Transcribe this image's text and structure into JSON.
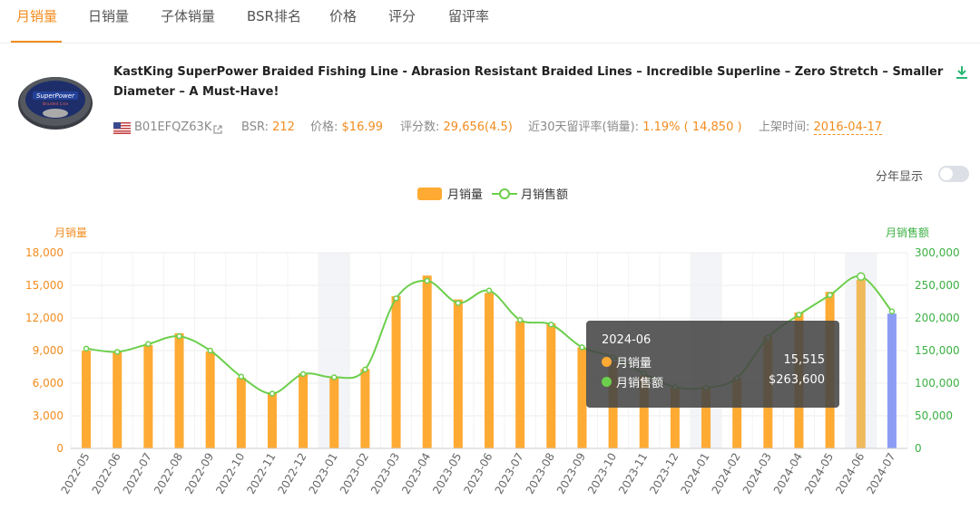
{
  "tabs": [
    {
      "label": "月销量",
      "active": true
    },
    {
      "label": "日销量",
      "active": false
    },
    {
      "label": "子体销量",
      "active": false
    },
    {
      "label": "BSR排名",
      "active": false
    },
    {
      "label": "价格",
      "active": false
    },
    {
      "label": "评分",
      "active": false
    },
    {
      "label": "留评率",
      "active": false
    }
  ],
  "product": {
    "title": "KastKing SuperPower Braided Fishing Line - Abrasion Resistant Braided Lines – Incredible Superline – Zero Stretch – Smaller Diameter – A Must-Have!",
    "asin": "B01EFQZ63K",
    "bsr_label": "BSR:",
    "bsr_value": "212",
    "price_label": "价格:",
    "price_value": "$16.99",
    "ratings_label": "评分数:",
    "ratings_value": "29,656(4.5)",
    "review_rate_label": "近30天留评率(销量):",
    "review_rate_value": "1.19% ( 14,850 )",
    "listed_label": "上架时间:",
    "listed_value": "2016-04-17",
    "spool_brand": "SuperPower",
    "spool_sub": "Braided Line"
  },
  "controls": {
    "year_toggle_label": "分年显示",
    "year_toggle_on": false
  },
  "colors": {
    "accent": "#f28c1e",
    "bar": "#ffaa33",
    "bar_highlight": "#f0b95a",
    "bar_last": "#8c9cf5",
    "line": "#6ccf4c",
    "band": "#f3f4f8"
  },
  "chart_data": {
    "type": "bar",
    "legend": [
      {
        "name": "月销量",
        "kind": "bar"
      },
      {
        "name": "月销售额",
        "kind": "line"
      }
    ],
    "left_axis": {
      "title": "月销量",
      "min": 0,
      "max": 18000,
      "ticks": [
        "0",
        "3,000",
        "6,000",
        "9,000",
        "12,000",
        "15,000",
        "18,000"
      ]
    },
    "right_axis": {
      "title": "月销售额",
      "min": 0,
      "max": 300000,
      "ticks": [
        "0",
        "50,000",
        "100,000",
        "150,000",
        "200,000",
        "250,000",
        "300,000"
      ]
    },
    "categories": [
      "2022-05",
      "2022-06",
      "2022-07",
      "2022-08",
      "2022-09",
      "2022-10",
      "2022-11",
      "2022-12",
      "2023-01",
      "2023-02",
      "2023-03",
      "2023-04",
      "2023-05",
      "2023-06",
      "2023-07",
      "2023-08",
      "2023-09",
      "2023-10",
      "2023-11",
      "2023-12",
      "2024-01",
      "2024-02",
      "2024-03",
      "2024-04",
      "2024-05",
      "2024-06",
      "2024-07"
    ],
    "series": [
      {
        "name": "月销量",
        "axis": "left",
        "values": [
          9000,
          8900,
          9500,
          10600,
          8900,
          6500,
          5100,
          6900,
          6600,
          7300,
          14000,
          15900,
          13700,
          14300,
          11700,
          11500,
          9300,
          8000,
          6700,
          5600,
          5700,
          6500,
          10300,
          12500,
          14400,
          15515,
          12400
        ]
      },
      {
        "name": "月销售额",
        "axis": "right",
        "values": [
          153000,
          148000,
          160000,
          172000,
          150000,
          110000,
          84000,
          114000,
          109000,
          121000,
          230000,
          257000,
          223000,
          242000,
          197000,
          190000,
          155000,
          140000,
          115000,
          94000,
          93000,
          108000,
          170000,
          205000,
          235000,
          263600,
          210000
        ]
      }
    ],
    "shaded_categories": [
      "2023-01",
      "2024-01",
      "2024-06"
    ],
    "hovered_category": "2024-06",
    "grid": true
  },
  "tooltip": {
    "title": "2024-06",
    "rows": [
      {
        "label": "月销量",
        "value": "15,515"
      },
      {
        "label": "月销售额",
        "value": "$263,600"
      }
    ]
  }
}
